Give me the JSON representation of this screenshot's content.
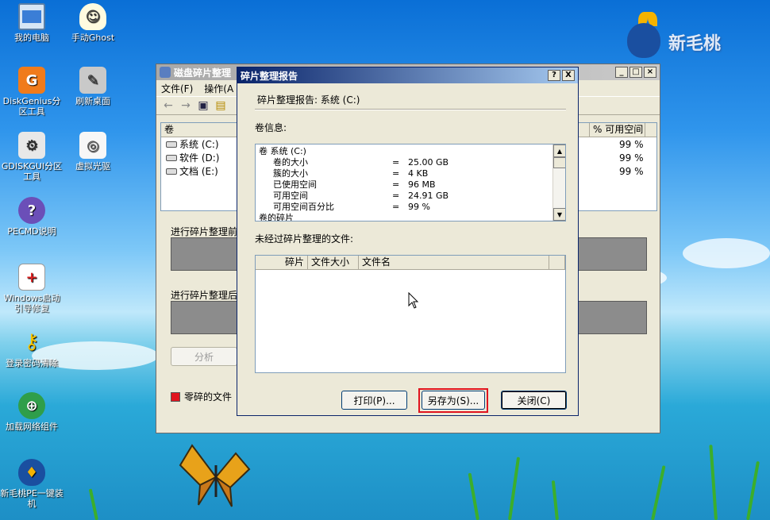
{
  "desktop": {
    "icons": [
      {
        "label": "我的电脑",
        "icon": "computer-icon"
      },
      {
        "label": "手动Ghost",
        "icon": "ghost-icon"
      },
      {
        "label": "DiskGenius分区工具",
        "icon": "diskgenius-icon"
      },
      {
        "label": "刷新桌面",
        "icon": "refresh-desktop-icon"
      },
      {
        "label": "GDISKGUI分区工具",
        "icon": "gdiskgui-icon"
      },
      {
        "label": "虚拟光驱",
        "icon": "virtual-drive-icon"
      },
      {
        "label": "PECMD说明",
        "icon": "help-icon"
      },
      {
        "label": "Windows启动引导修复",
        "icon": "boot-repair-icon"
      },
      {
        "label": "登录密码清除",
        "icon": "key-icon"
      },
      {
        "label": "加载网络组件",
        "icon": "network-icon"
      },
      {
        "label": "新毛桃PE一键装机",
        "icon": "installer-icon"
      }
    ],
    "brand_logo": "新毛桃"
  },
  "back_window": {
    "title": "磁盘碎片整理",
    "menu": [
      "文件(F)",
      "操作(A"
    ],
    "columns": {
      "volume": "卷",
      "free_pct": "% 可用空间"
    },
    "volumes": [
      {
        "name": "系统 (C:)",
        "free": "99 %"
      },
      {
        "name": "软件 (D:)",
        "free": "99 %"
      },
      {
        "name": "文档 (E:)",
        "free": "99 %"
      }
    ],
    "before_label": "进行碎片整理前",
    "after_label": "进行碎片整理后",
    "analyze_button": "分析",
    "legend_fragmented": "零碎的文件"
  },
  "dialog": {
    "title": "碎片整理报告",
    "help_btn": "?",
    "close_btn": "X",
    "report_heading": "碎片整理报告: 系统 (C:)",
    "volume_info_label": "卷信息:",
    "info_rows": [
      {
        "key": "卷 系统 (C:)",
        "eq": "",
        "val": "",
        "indent": false
      },
      {
        "key": "卷的大小",
        "eq": "=",
        "val": "25.00 GB",
        "indent": true
      },
      {
        "key": "簇的大小",
        "eq": "=",
        "val": "4 KB",
        "indent": true
      },
      {
        "key": "已使用空间",
        "eq": "=",
        "val": "96 MB",
        "indent": true
      },
      {
        "key": "可用空间",
        "eq": "=",
        "val": "24.91 GB",
        "indent": true
      },
      {
        "key": "可用空间百分比",
        "eq": "=",
        "val": "99 %",
        "indent": true
      },
      {
        "key": "卷的碎片",
        "eq": "",
        "val": "",
        "indent": false
      }
    ],
    "unfragmented_label": "未经过碎片整理的文件:",
    "file_columns": [
      "碎片",
      "文件大小",
      "文件名"
    ],
    "print_button": "打印(P)...",
    "save_as_button": "另存为(S)...",
    "close_button": "关闭(C)",
    "highlight_color": "#e0141e"
  }
}
